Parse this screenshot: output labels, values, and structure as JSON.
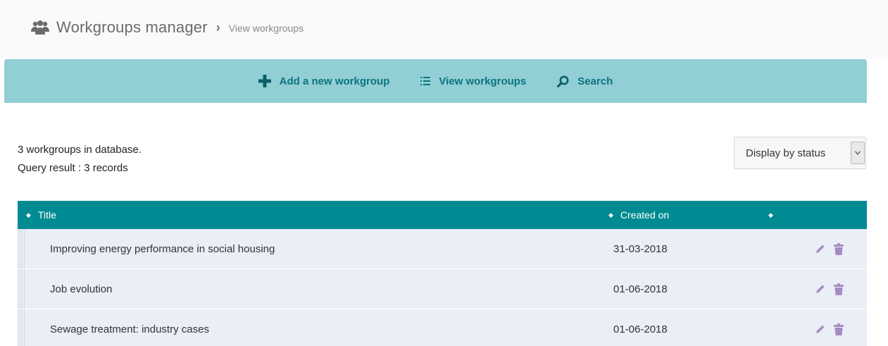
{
  "header": {
    "title": "Workgroups manager",
    "separator": "›",
    "current": "View workgroups"
  },
  "toolbar": {
    "add_label": "Add a new workgroup",
    "view_label": "View workgroups",
    "search_label": "Search"
  },
  "summary": {
    "line1": "3 workgroups in database.",
    "line2": "Query result : 3 records"
  },
  "status_select": {
    "selected": "Display by status"
  },
  "table": {
    "headers": [
      "Title",
      "Created on",
      ""
    ],
    "rows": [
      {
        "title": "Improving energy performance in social housing",
        "created": "31-03-2018"
      },
      {
        "title": "Job evolution",
        "created": "01-06-2018"
      },
      {
        "title": "Sewage treatment: industry cases",
        "created": "01-06-2018"
      }
    ]
  },
  "icons": {
    "breadcrumb": "users-icon",
    "add": "plus-icon",
    "view": "list-icon",
    "search": "magnifier-icon",
    "edit": "pencil-icon",
    "delete": "trash-icon",
    "sort": "sort-icon",
    "select": "chevron-down-icon"
  },
  "colors": {
    "toolbar_bg": "#91cfd4",
    "toolbar_text": "#0b7480",
    "table_header_bg": "#008b92",
    "row_bg": "#eaeef6",
    "action_icon": "#a58bc1"
  }
}
